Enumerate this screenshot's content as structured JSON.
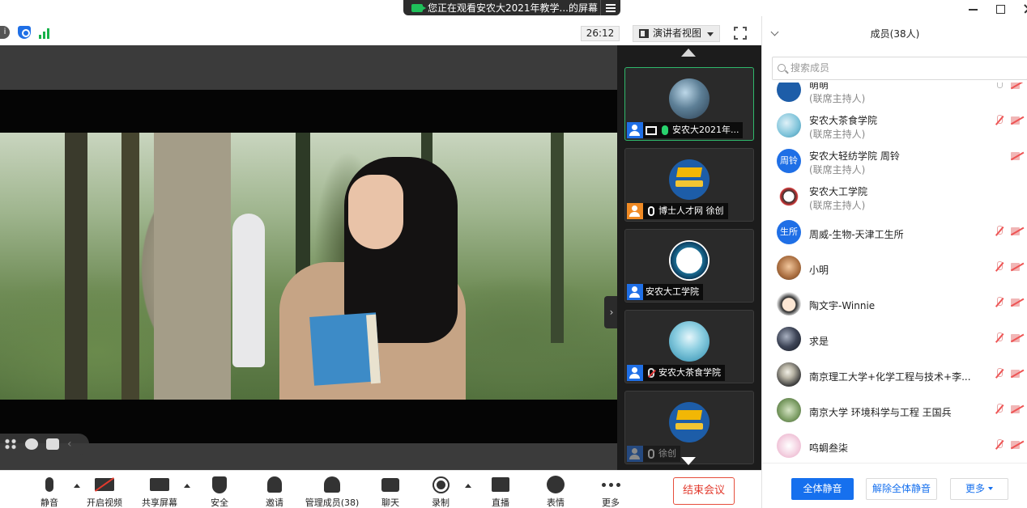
{
  "window": {
    "share_banner": "您正在观看安农大2021年教学...的屏幕"
  },
  "topbar": {
    "timer": "26:12",
    "view_mode": "演讲者视图"
  },
  "gallery": {
    "tiles": [
      {
        "name": "安农大2021年...",
        "avatar": "av-sky",
        "user_icon": "user-icon",
        "mic": "speaking",
        "active": true,
        "sharing": true
      },
      {
        "name": "博士人才网 徐创",
        "avatar": "av-cap",
        "user_icon": "host-user-icon",
        "mic": "on",
        "active": false,
        "sharing": false
      },
      {
        "name": "安农大工学院",
        "avatar": "av-ink",
        "user_icon": "user-icon",
        "mic": "none",
        "active": false,
        "sharing": false
      },
      {
        "name": "安农大茶食学院",
        "avatar": "av-water",
        "user_icon": "user-icon",
        "mic": "muted",
        "active": false,
        "sharing": false
      },
      {
        "name": "徐创",
        "avatar": "av-cap",
        "user_icon": "user-icon",
        "mic": "on",
        "active": false,
        "sharing": false,
        "dim": true
      }
    ]
  },
  "toolbar": {
    "buttons": [
      {
        "id": "mute",
        "label": "静音"
      },
      {
        "id": "video",
        "label": "开启视频"
      },
      {
        "id": "share",
        "label": "共享屏幕"
      },
      {
        "id": "security",
        "label": "安全"
      },
      {
        "id": "invite",
        "label": "邀请"
      },
      {
        "id": "members",
        "label": "管理成员(38)"
      },
      {
        "id": "chat",
        "label": "聊天"
      },
      {
        "id": "record",
        "label": "录制"
      },
      {
        "id": "live",
        "label": "直播"
      },
      {
        "id": "reactions",
        "label": "表情"
      },
      {
        "id": "more",
        "label": "更多"
      }
    ],
    "end_meeting": "结束会议"
  },
  "panel": {
    "title": "成员(38人)",
    "search_placeholder": "搜索成员",
    "members": [
      {
        "name": "萌萌",
        "role": "(联席主持人)",
        "avatar": "cap",
        "initials": "",
        "mic": "grey",
        "cam": true
      },
      {
        "name": "安农大茶食学院",
        "role": "(联席主持人)",
        "avatar": "sky",
        "initials": "",
        "mic": "muted",
        "cam": true
      },
      {
        "name": "安农大轻纺学院 周铃",
        "role": "(联席主持人)",
        "avatar": "blue",
        "initials": "周铃",
        "mic": "",
        "cam": true
      },
      {
        "name": "安农大工学院",
        "role": "(联席主持人)",
        "avatar": "ink",
        "initials": "",
        "mic": "",
        "cam": false
      },
      {
        "name": "周威-生物-天津工生所",
        "role": "",
        "avatar": "blue",
        "initials": "生所",
        "mic": "muted",
        "cam": true
      },
      {
        "name": "小明",
        "role": "",
        "avatar": "boy",
        "initials": "",
        "mic": "muted",
        "cam": true
      },
      {
        "name": "陶文宇-Winnie",
        "role": "",
        "avatar": "cartoon",
        "initials": "",
        "mic": "muted",
        "cam": true
      },
      {
        "name": "求是",
        "role": "",
        "avatar": "dark",
        "initials": "",
        "mic": "muted",
        "cam": true
      },
      {
        "name": "南京理工大学+化学工程与技术+李...",
        "role": "",
        "avatar": "moon",
        "initials": "",
        "mic": "muted",
        "cam": true
      },
      {
        "name": "南京大学 环境科学与工程 王国兵",
        "role": "",
        "avatar": "nature",
        "initials": "",
        "mic": "muted",
        "cam": true
      },
      {
        "name": "鸣蜩叁柒",
        "role": "",
        "avatar": "pink",
        "initials": "",
        "mic": "muted",
        "cam": true
      }
    ],
    "mute_all": "全体静音",
    "unmute_all": "解除全体静音",
    "more": "更多"
  }
}
